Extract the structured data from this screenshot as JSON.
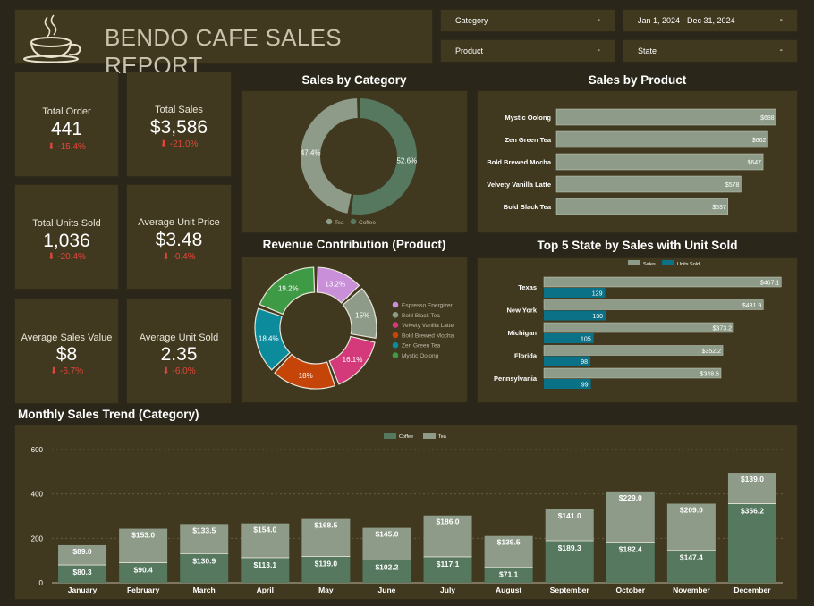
{
  "header": {
    "title": "BENDO CAFE SALES REPORT"
  },
  "filters": [
    {
      "label": "Category"
    },
    {
      "label": "Jan 1, 2024 - Dec 31, 2024"
    },
    {
      "label": "Product"
    },
    {
      "label": "State"
    }
  ],
  "kpis": [
    {
      "label": "Total Order",
      "value": "441",
      "delta": "-15.4%"
    },
    {
      "label": "Total Sales",
      "value": "$3,586",
      "delta": "-21.0%"
    },
    {
      "label": "Total Units Sold",
      "value": "1,036",
      "delta": "-20.4%"
    },
    {
      "label": "Average Unit Price",
      "value": "$3.48",
      "delta": "-0.4%"
    },
    {
      "label": "Average Sales Value",
      "value": "$8",
      "delta": "-6.7%"
    },
    {
      "label": "Average Unit Sold",
      "value": "2.35",
      "delta": "-6.0%"
    }
  ],
  "colors": {
    "tea": "#8e9b88",
    "coffee": "#55785f",
    "units": "#0b7187",
    "panel": "#40391f",
    "background": "#2a2619",
    "delta": "#e0463b"
  },
  "chart_data": [
    {
      "type": "pie",
      "title": "Sales by Category",
      "labels": [
        "Tea",
        "Coffee"
      ],
      "values": [
        47.4,
        52.6
      ],
      "value_labels": [
        "47.4%",
        "52.6%"
      ],
      "colors": [
        "#8e9b88",
        "#55785f"
      ],
      "legend": "bottom"
    },
    {
      "type": "bar",
      "title": "Sales by Product",
      "orientation": "horizontal",
      "categories": [
        "Mystic Oolong",
        "Zen Green Tea",
        "Bold Brewed Mocha",
        "Velvety Vanilla Latte",
        "Bold Black Tea"
      ],
      "values": [
        688,
        662,
        647,
        578,
        537
      ],
      "value_labels": [
        "$688",
        "$662",
        "$647",
        "$578",
        "$537"
      ],
      "xlim": [
        0,
        700
      ]
    },
    {
      "type": "pie",
      "title": "Revenue Contribution (Product)",
      "labels": [
        "Espresso Energizer",
        "Bold Black Tea",
        "Velvety Vanilla Latte",
        "Bold Brewed Mocha",
        "Zen Green Tea",
        "Mystic Oolong"
      ],
      "values": [
        13.2,
        15,
        16.1,
        18,
        18.4,
        19.2
      ],
      "value_labels": [
        "13.2%",
        "15%",
        "16.1%",
        "18%",
        "18.4%",
        "19.2%"
      ],
      "colors": [
        "#c98fd9",
        "#8e9b88",
        "#d4397a",
        "#c54508",
        "#0b8b9c",
        "#3f9a45"
      ],
      "legend": "right"
    },
    {
      "type": "bar",
      "title": "Top 5 State by Sales with Unit Sold",
      "orientation": "horizontal",
      "categories": [
        "Texas",
        "New York",
        "Michigan",
        "Florida",
        "Pennsylvania"
      ],
      "series": [
        {
          "name": "Sales",
          "values": [
            467.1,
            431.9,
            373.2,
            352.2,
            348.6
          ],
          "value_labels": [
            "$467.1",
            "$431.9",
            "$373.2",
            "$352.2",
            "$348.6"
          ]
        },
        {
          "name": "Units Sold",
          "values": [
            129,
            130,
            105,
            98,
            99
          ],
          "value_labels": [
            "129",
            "130",
            "105",
            "98",
            "99"
          ]
        }
      ],
      "legend": "top"
    },
    {
      "type": "bar",
      "stacked": true,
      "title": "Monthly Sales Trend (Category)",
      "categories": [
        "January",
        "February",
        "March",
        "April",
        "May",
        "June",
        "July",
        "August",
        "September",
        "October",
        "November",
        "December"
      ],
      "series": [
        {
          "name": "Coffee",
          "values": [
            80.3,
            90.4,
            130.9,
            113.1,
            119.0,
            102.2,
            117.1,
            71.1,
            189.3,
            182.4,
            147.4,
            356.2
          ],
          "value_labels": [
            "$80.3",
            "$90.4",
            "$130.9",
            "$113.1",
            "$119.0",
            "$102.2",
            "$117.1",
            "$71.1",
            "$189.3",
            "$182.4",
            "$147.4",
            "$356.2"
          ]
        },
        {
          "name": "Tea",
          "values": [
            89.0,
            153.0,
            133.5,
            154.0,
            168.5,
            145.0,
            186.0,
            139.5,
            141.0,
            229.0,
            209.0,
            139.0
          ],
          "value_labels": [
            "$89.0",
            "$153.0",
            "$133.5",
            "$154.0",
            "$168.5",
            "$145.0",
            "$186.0",
            "$139.5",
            "$141.0",
            "$229.0",
            "$209.0",
            "$139.0"
          ]
        }
      ],
      "ylim": [
        0,
        600
      ],
      "yticks": [
        "0",
        "200",
        "400",
        "600"
      ],
      "grid": true,
      "legend": "top"
    }
  ]
}
